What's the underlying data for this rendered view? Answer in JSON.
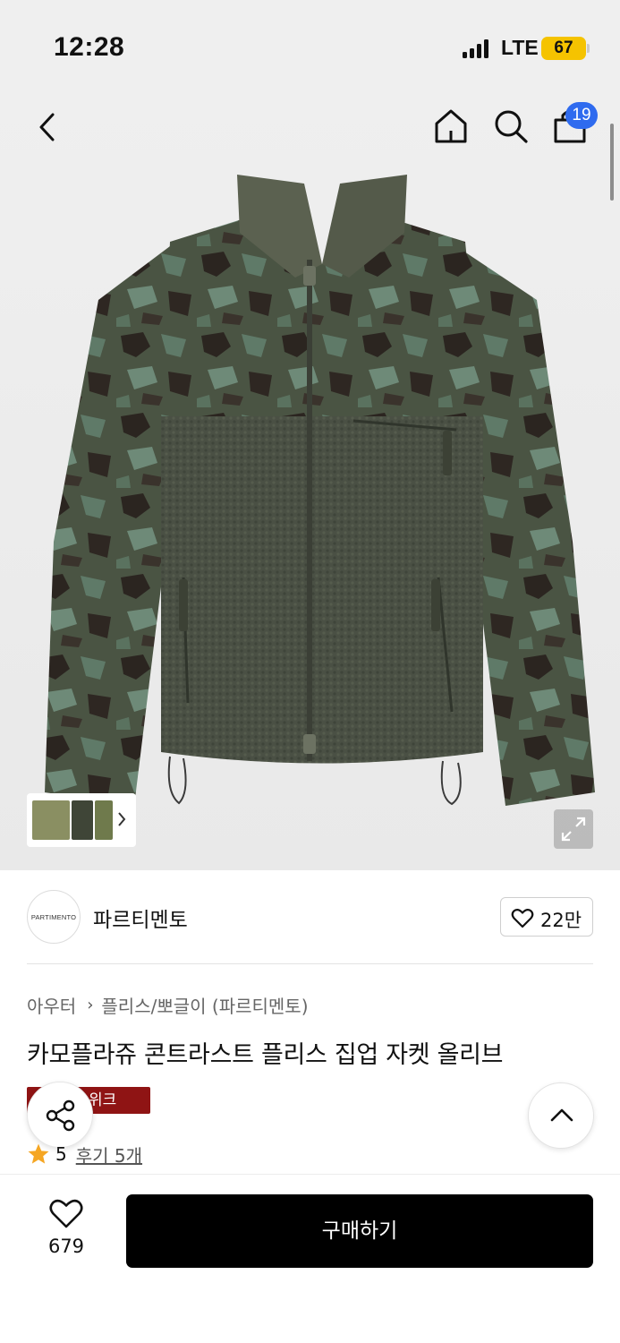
{
  "status_bar": {
    "time": "12:28",
    "network": "LTE",
    "battery": "67"
  },
  "header": {
    "cart_count": "19",
    "icons": [
      "chevron-left-icon",
      "home-icon",
      "search-icon",
      "shopping-bag-icon"
    ]
  },
  "gallery": {
    "thumbnail_colors": [
      "#8a8f62",
      "#3f4537",
      "#6f7a4c"
    ]
  },
  "brand": {
    "logo_text": "PARTIMENTO",
    "name": "파르티멘토",
    "like_count": "22만"
  },
  "product": {
    "breadcrumb": [
      "아우터",
      "플리스/뽀글이 (파르티멘토)"
    ],
    "title": "카모플라쥬 콘트라스트 플리스 집업 자켓 올리브",
    "promo_badge": "런스위크",
    "rating": "5",
    "review_link": "후기 5개"
  },
  "bottom_bar": {
    "wish_count": "679",
    "buy_label": "구매하기"
  },
  "colors": {
    "accent_blue": "#2f6bef",
    "promo_red": "#8f1414",
    "star": "#f5a623",
    "buy_button": "#000000"
  }
}
